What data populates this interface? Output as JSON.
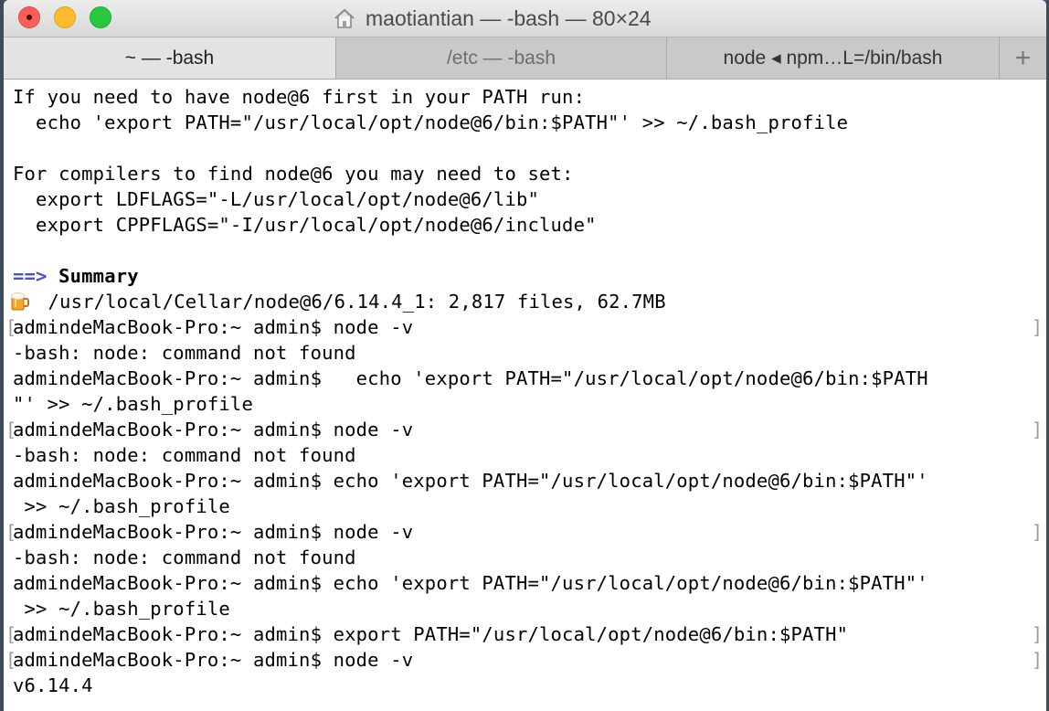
{
  "window": {
    "title": "maotiantian — -bash — 80×24",
    "title_icon": "home-icon"
  },
  "tabs": [
    {
      "label": "~ — -bash",
      "active": true
    },
    {
      "label": "/etc — -bash",
      "active": false
    },
    {
      "label": "node ◂ npm…L=/bin/bash",
      "active": false
    }
  ],
  "new_tab_label": "+",
  "terminal": {
    "lines": [
      "If you need to have node@6 first in your PATH run:",
      "  echo 'export PATH=\"/usr/local/opt/node@6/bin:$PATH\"' >> ~/.bash_profile",
      "",
      "For compilers to find node@6 you may need to set:",
      "  export LDFLAGS=\"-L/usr/local/opt/node@6/lib\"",
      "  export CPPFLAGS=\"-I/usr/local/opt/node@6/include\"",
      "",
      "",
      " /usr/local/Cellar/node@6/6.14.4_1: 2,817 files, 62.7MB",
      "admindeMacBook-Pro:~ admin$ node -v",
      "-bash: node: command not found",
      "admindeMacBook-Pro:~ admin$   echo 'export PATH=\"/usr/local/opt/node@6/bin:$PATH",
      "\"' >> ~/.bash_profile",
      "admindeMacBook-Pro:~ admin$ node -v",
      "-bash: node: command not found",
      "admindeMacBook-Pro:~ admin$ echo 'export PATH=\"/usr/local/opt/node@6/bin:$PATH\"'",
      " >> ~/.bash_profile",
      "admindeMacBook-Pro:~ admin$ node -v",
      "-bash: node: command not found",
      "admindeMacBook-Pro:~ admin$ echo 'export PATH=\"/usr/local/opt/node@6/bin:$PATH\"'",
      " >> ~/.bash_profile",
      "admindeMacBook-Pro:~ admin$ export PATH=\"/usr/local/opt/node@6/bin:$PATH\"",
      "admindeMacBook-Pro:~ admin$ node -v",
      "v6.14.4"
    ],
    "summary_arrow": "==>",
    "summary_label": "Summary",
    "beer_icon": "beer-mug-icon",
    "accent_color": "#4a4fd6"
  }
}
